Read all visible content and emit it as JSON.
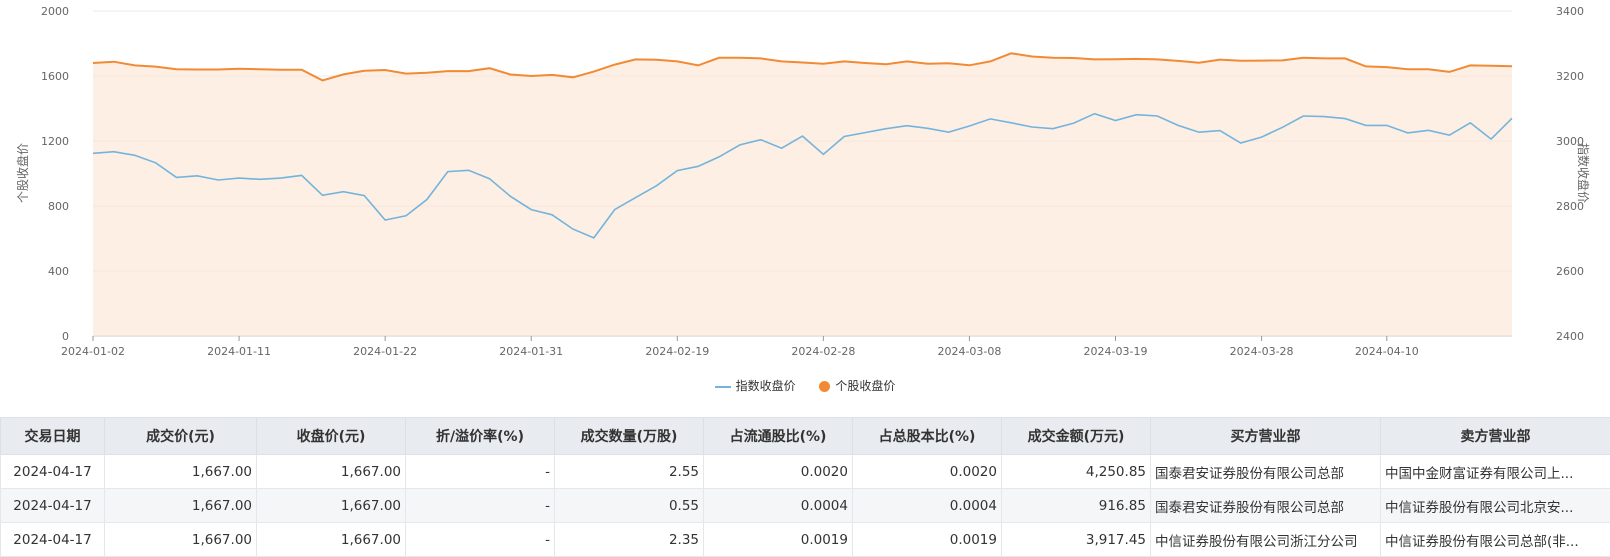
{
  "chart_data": {
    "type": "line",
    "y_left_label": "个股收盘价",
    "y_right_label": "指数收盘价",
    "y_left_ticks": [
      "2000",
      "1600",
      "1200",
      "800",
      "400",
      "0"
    ],
    "y_right_ticks": [
      "3400",
      "3200",
      "3000",
      "2800",
      "2600",
      "2400"
    ],
    "ylim_left": [
      0,
      2000
    ],
    "ylim_right": [
      2400,
      3400
    ],
    "x_tick_labels": [
      "2024-01-02",
      "2024-01-11",
      "2024-01-22",
      "2024-01-31",
      "2024-02-19",
      "2024-02-28",
      "2024-03-08",
      "2024-03-19",
      "2024-03-28",
      "2024-04-10"
    ],
    "x_tick_index": [
      0,
      7,
      14,
      21,
      28,
      35,
      42,
      49,
      56,
      62
    ],
    "grid": true,
    "legend_position": "bottom-center",
    "series": [
      {
        "name": "指数收盘价",
        "axis": "right",
        "color": "#73b4dd",
        "values": [
          2962,
          2967,
          2956,
          2933,
          2888,
          2893,
          2880,
          2886,
          2882,
          2886,
          2894,
          2833,
          2844,
          2832,
          2757,
          2770,
          2820,
          2906,
          2910,
          2884,
          2830,
          2789,
          2773,
          2729,
          2702,
          2789,
          2826,
          2862,
          2909,
          2922,
          2951,
          2988,
          3004,
          2978,
          3015,
          2959,
          3014,
          3026,
          3038,
          3047,
          3039,
          3027,
          3046,
          3068,
          3056,
          3043,
          3038,
          3055,
          3084,
          3063,
          3081,
          3077,
          3048,
          3027,
          3032,
          2994,
          3012,
          3042,
          3077,
          3075,
          3069,
          3048,
          3048,
          3025,
          3033,
          3018,
          3056,
          3006,
          3070
        ]
      },
      {
        "name": "个股收盘价",
        "axis": "left",
        "color": "#f28a33",
        "values": [
          1680,
          1688,
          1665,
          1658,
          1642,
          1640,
          1640,
          1645,
          1641,
          1639,
          1639,
          1573,
          1610,
          1632,
          1637,
          1615,
          1620,
          1630,
          1630,
          1648,
          1609,
          1600,
          1607,
          1592,
          1627,
          1670,
          1702,
          1700,
          1690,
          1665,
          1712,
          1712,
          1708,
          1690,
          1683,
          1675,
          1690,
          1680,
          1672,
          1690,
          1676,
          1679,
          1666,
          1690,
          1740,
          1720,
          1712,
          1711,
          1702,
          1703,
          1705,
          1702,
          1693,
          1682,
          1701,
          1694,
          1695,
          1696,
          1712,
          1708,
          1708,
          1659,
          1655,
          1641,
          1641,
          1625,
          1665,
          1663,
          1660
        ]
      }
    ]
  },
  "legend": {
    "index_label": "指数收盘价",
    "stock_label": "个股收盘价",
    "index_color": "#73b4dd",
    "stock_color": "#f28a33"
  },
  "table": {
    "headers": [
      "交易日期",
      "成交价(元)",
      "收盘价(元)",
      "折/溢价率(%)",
      "成交数量(万股)",
      "占流通股比(%)",
      "占总股本比(%)",
      "成交金额(万元)",
      "买方营业部",
      "卖方营业部"
    ],
    "rows": [
      [
        "2024-04-17",
        "1,667.00",
        "1,667.00",
        "-",
        "2.55",
        "0.0020",
        "0.0020",
        "4,250.85",
        "国泰君安证券股份有限公司总部",
        "中国中金财富证券有限公司上..."
      ],
      [
        "2024-04-17",
        "1,667.00",
        "1,667.00",
        "-",
        "0.55",
        "0.0004",
        "0.0004",
        "916.85",
        "国泰君安证券股份有限公司总部",
        "中信证券股份有限公司北京安..."
      ],
      [
        "2024-04-17",
        "1,667.00",
        "1,667.00",
        "-",
        "2.35",
        "0.0019",
        "0.0019",
        "3,917.45",
        "中信证券股份有限公司浙江分公司",
        "中信证券股份有限公司总部(非..."
      ]
    ]
  }
}
